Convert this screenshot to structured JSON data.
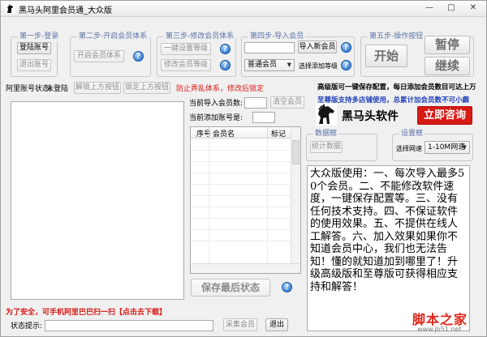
{
  "window": {
    "title": "黑马头阿里会员通_大众版"
  },
  "step1": {
    "title": "第一步-登录",
    "login": "登陆账号",
    "logout": "退出账号"
  },
  "step2": {
    "title": "第二步-开启会员体系",
    "open": "开启会员体系"
  },
  "step3": {
    "title": "第三步-修改会员体系",
    "one_click": "一键设置等级",
    "modify": "修改会员等级"
  },
  "step4": {
    "title": "第四步-导入会员",
    "import": "导入新会员",
    "level_value": "普通会员",
    "select_level": "选择添加等级"
  },
  "step5": {
    "title": "第五步-操作按钮",
    "start": "开始",
    "pause": "暂停",
    "resume": "继续"
  },
  "status_row": {
    "label": "阿里账号状态:",
    "value": "未登陆",
    "unlock": "解锁上方按钮",
    "lock": "锁定上方按钮",
    "warning": "防止弄乱体系，修改后锁定"
  },
  "counts": {
    "imported_label": "当前导入会员数:",
    "clear": "清空会员",
    "added_label": "当前添加账号是:"
  },
  "table": {
    "columns": [
      "序号",
      "会员名",
      "标记"
    ]
  },
  "save_state": "保存最后状态",
  "promo": {
    "line1": "高级版可一键保存配置，每日添加会员数目可达上万",
    "line2": "至尊版支持多店铺使用，总累计加会员数不可小觑",
    "brand": "黑马头软件",
    "consult": "立即咨询"
  },
  "data_box": {
    "title": "数据框",
    "stats": "统计数据"
  },
  "settings_box": {
    "title": "设置框",
    "network_label": "选择网速",
    "network_value": "1-10M网速"
  },
  "notice": "大众版使用：一、每次导入最多50个会员。二、不能修改软件速度，一键保存配置等。三、没有任何技术支持。四、不保证软件的使用效果。五、不提供在线人工解答。六、加入效果如果你不知道会员中心，我们也无法告知！懂的就知道加到哪里了！升级高级版和至尊版可获得相应支持和解答！",
  "footer": {
    "safety": "为了安全，可手机阿里巴巴扫一扫【点击去下载】",
    "status_label": "状态提示:",
    "collect": "采集会员",
    "exit": "退出"
  },
  "watermark": {
    "text": "脚本之家",
    "url": "www.jb51.net"
  },
  "colors": {
    "group_title": "#5b73a8",
    "warning": "#d81a14",
    "promo_blue": "#1f3fb8",
    "consult_bg": "#d81a14"
  }
}
